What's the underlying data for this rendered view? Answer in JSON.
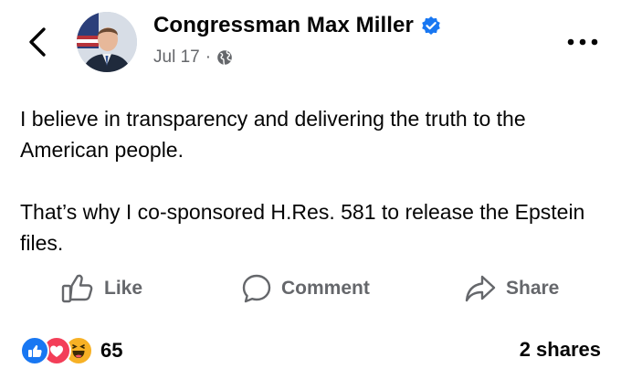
{
  "post": {
    "author_name": "Congressman Max Miller",
    "date": "Jul 17",
    "separator": "·",
    "verified_icon": "verified-badge-icon",
    "privacy_icon": "globe-icon",
    "paragraphs": [
      "I believe in transparency and delivering the truth to the American people.",
      "That’s why I co-sponsored H.Res. 581 to release the Epstein files."
    ]
  },
  "actions": {
    "like_label": "Like",
    "comment_label": "Comment",
    "share_label": "Share"
  },
  "engagement": {
    "reaction_icons": [
      "like-reaction-icon",
      "love-reaction-icon",
      "haha-reaction-icon"
    ],
    "reaction_count": "65",
    "shares": "2 shares"
  },
  "colors": {
    "verified_blue": "#1877f2",
    "meta_gray": "#65676b",
    "love_red": "#f33e58",
    "haha_yellow": "#f7b125"
  }
}
